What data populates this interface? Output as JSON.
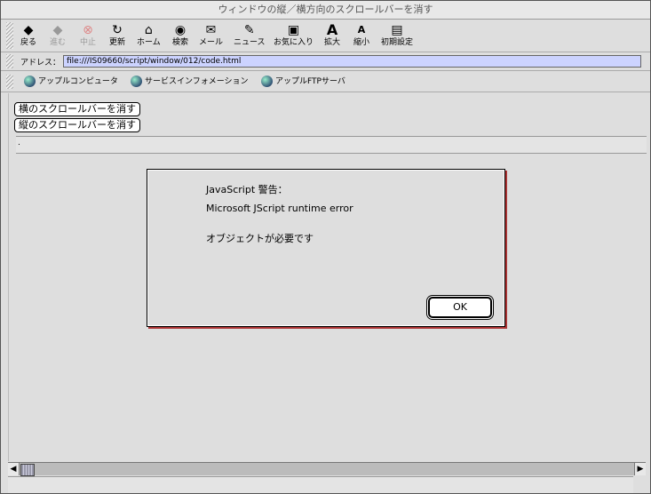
{
  "window": {
    "title": "ウィンドウの縦／横方向のスクロールバーを消す"
  },
  "toolbar": {
    "buttons": [
      {
        "label": "戻る",
        "icon": "back-arrow-icon",
        "glyph": "◆"
      },
      {
        "label": "進む",
        "icon": "forward-arrow-icon",
        "glyph": "◆"
      },
      {
        "label": "中止",
        "icon": "stop-icon",
        "glyph": "⊗"
      },
      {
        "label": "更新",
        "icon": "refresh-icon",
        "glyph": "↻"
      },
      {
        "label": "ホーム",
        "icon": "home-icon",
        "glyph": "⌂"
      },
      {
        "label": "検索",
        "icon": "search-globe-icon",
        "glyph": "◉"
      },
      {
        "label": "メール",
        "icon": "mail-icon",
        "glyph": "✉"
      },
      {
        "label": "ニュース",
        "icon": "news-icon",
        "glyph": "✎"
      },
      {
        "label": "お気に入り",
        "icon": "favorites-icon",
        "glyph": "▣"
      },
      {
        "label": "拡大",
        "icon": "enlarge-text-icon",
        "glyph": "A"
      },
      {
        "label": "縮小",
        "icon": "shrink-text-icon",
        "glyph": "A"
      },
      {
        "label": "初期設定",
        "icon": "preferences-icon",
        "glyph": "▤"
      }
    ]
  },
  "address": {
    "label": "アドレス：",
    "value": "file:///IS09660/script/window/012/code.html"
  },
  "links": [
    {
      "label": "アップルコンピュータ"
    },
    {
      "label": "サービスインフォメーション"
    },
    {
      "label": "アップルFTPサーバ"
    }
  ],
  "page": {
    "button_horizontal": "横のスクロールバーを消す",
    "button_vertical": "縦のスクロールバーを消す",
    "field_value": "."
  },
  "dialog": {
    "title": "JavaScript 警告：",
    "message1": "Microsoft JScript runtime error",
    "message2": "オブジェクトが必要です",
    "ok_label": "OK"
  },
  "scrollbar": {
    "left_arrow": "◀",
    "right_arrow": "▶"
  }
}
